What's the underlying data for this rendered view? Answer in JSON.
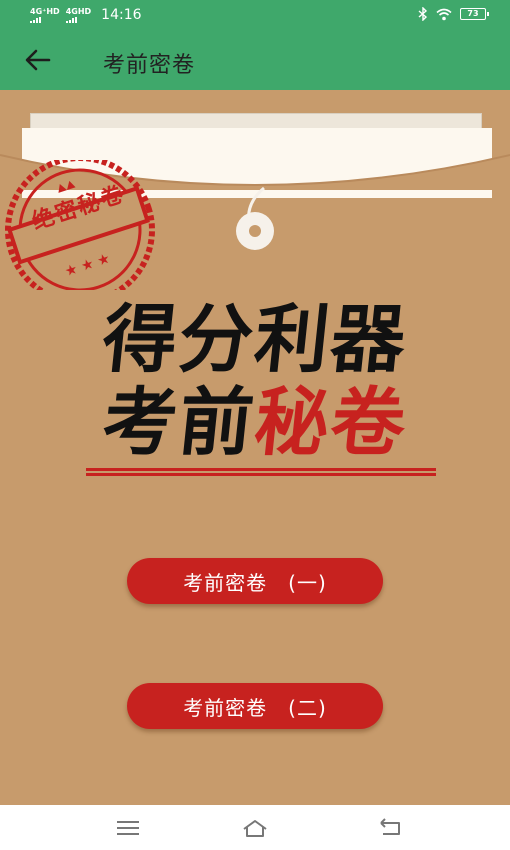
{
  "status_bar": {
    "network1": "4G⁺HD",
    "network2": "4GHD",
    "time": "14:16",
    "battery": "73",
    "icons": [
      "bluetooth-icon",
      "wifi-icon",
      "battery-icon"
    ]
  },
  "app_bar": {
    "title": "考前密卷",
    "back_icon": "arrow-left-icon"
  },
  "stamp": {
    "text": "绝密秘卷"
  },
  "headline": {
    "line1": "得分利器",
    "line2_black": "考前",
    "line2_red": "秘卷"
  },
  "buttons": {
    "paper1": "考前密卷　(一)",
    "paper2": "考前密卷　(二)"
  },
  "colors": {
    "header": "#3fa86b",
    "background": "#c79b6c",
    "accent_red": "#c7221f"
  },
  "nav_bar": {
    "icons": [
      "menu-icon",
      "home-icon",
      "back-icon"
    ]
  }
}
